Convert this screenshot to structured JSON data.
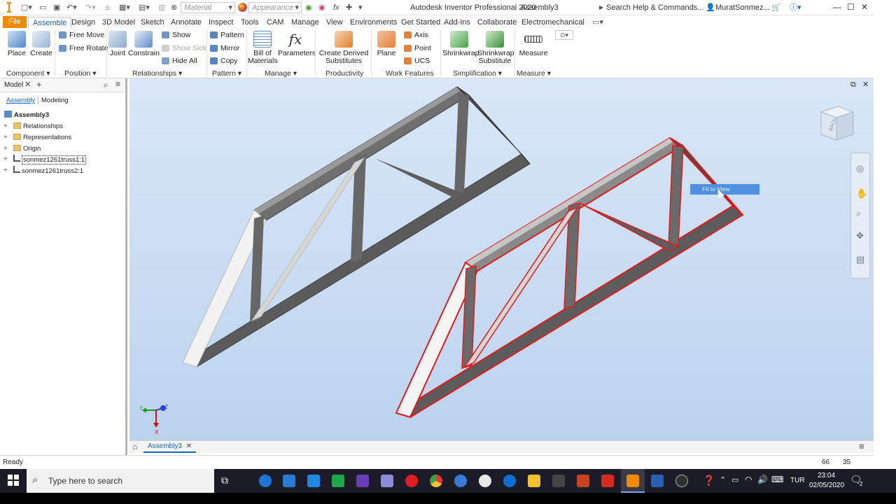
{
  "titlebar": {
    "app_title": "Autodesk Inventor Professional 2020",
    "document_title": "Assembly3",
    "material_combo": "Material",
    "appearance_combo": "Appearance",
    "search_placeholder": "Search Help & Commands...",
    "user_name": "MuratSonmez..."
  },
  "tabs": [
    "File",
    "Assemble",
    "Design",
    "3D Model",
    "Sketch",
    "Annotate",
    "Inspect",
    "Tools",
    "CAM",
    "Manage",
    "View",
    "Environments",
    "Get Started",
    "Add-Ins",
    "Collaborate",
    "Electromechanical"
  ],
  "ribbon": {
    "place": "Place",
    "create": "Create",
    "free_move": "Free Move",
    "free_rotate": "Free Rotate",
    "joint": "Joint",
    "constrain": "Constrain",
    "show": "Show",
    "show_sick": "Show Sick",
    "hide_all": "Hide All",
    "pattern": "Pattern",
    "mirror": "Mirror",
    "copy": "Copy",
    "bom_line1": "Bill of",
    "bom_line2": "Materials",
    "parameters": "Parameters",
    "derived_line1": "Create Derived",
    "derived_line2": "Substitutes",
    "plane": "Plane",
    "axis": "Axis",
    "point": "Point",
    "ucs": "UCS",
    "shrinkwrap": "Shrinkwrap",
    "shrinkwrap_sub1": "Shrinkwrap",
    "shrinkwrap_sub2": "Substitute",
    "measure": "Measure",
    "groups": {
      "component": "Component",
      "position": "Position",
      "relationships": "Relationships",
      "pattern": "Pattern",
      "manage": "Manage",
      "productivity": "Productivity",
      "work_features": "Work Features",
      "simplification": "Simplification",
      "measure": "Measure"
    }
  },
  "browser": {
    "tab_model": "Model",
    "sub_assembly": "Assembly",
    "sub_modeling": "Modeling",
    "root": "Assembly3",
    "items": [
      "Relationships",
      "Representations",
      "Origin",
      "sonmez1261truss1:1",
      "sonmez1261truss2:1"
    ]
  },
  "viewport": {
    "tooltip": "Fit to View",
    "viewcube_label": "BACK",
    "triad_y": "Y",
    "triad_z": "Z",
    "triad_x": "X"
  },
  "docbar": {
    "tab": "Assembly3"
  },
  "status": {
    "text": "Ready",
    "count1": "66",
    "count2": "35"
  },
  "taskbar": {
    "search_placeholder": "Type here to search",
    "language": "TUR",
    "time": "23:04",
    "date": "02/05/2020",
    "notifications": "2"
  },
  "colors": {
    "accent": "#1a66c4",
    "file_tab": "#f08a00",
    "viewport_bg": "#c8dcf3",
    "highlight": "#e11b1b"
  }
}
